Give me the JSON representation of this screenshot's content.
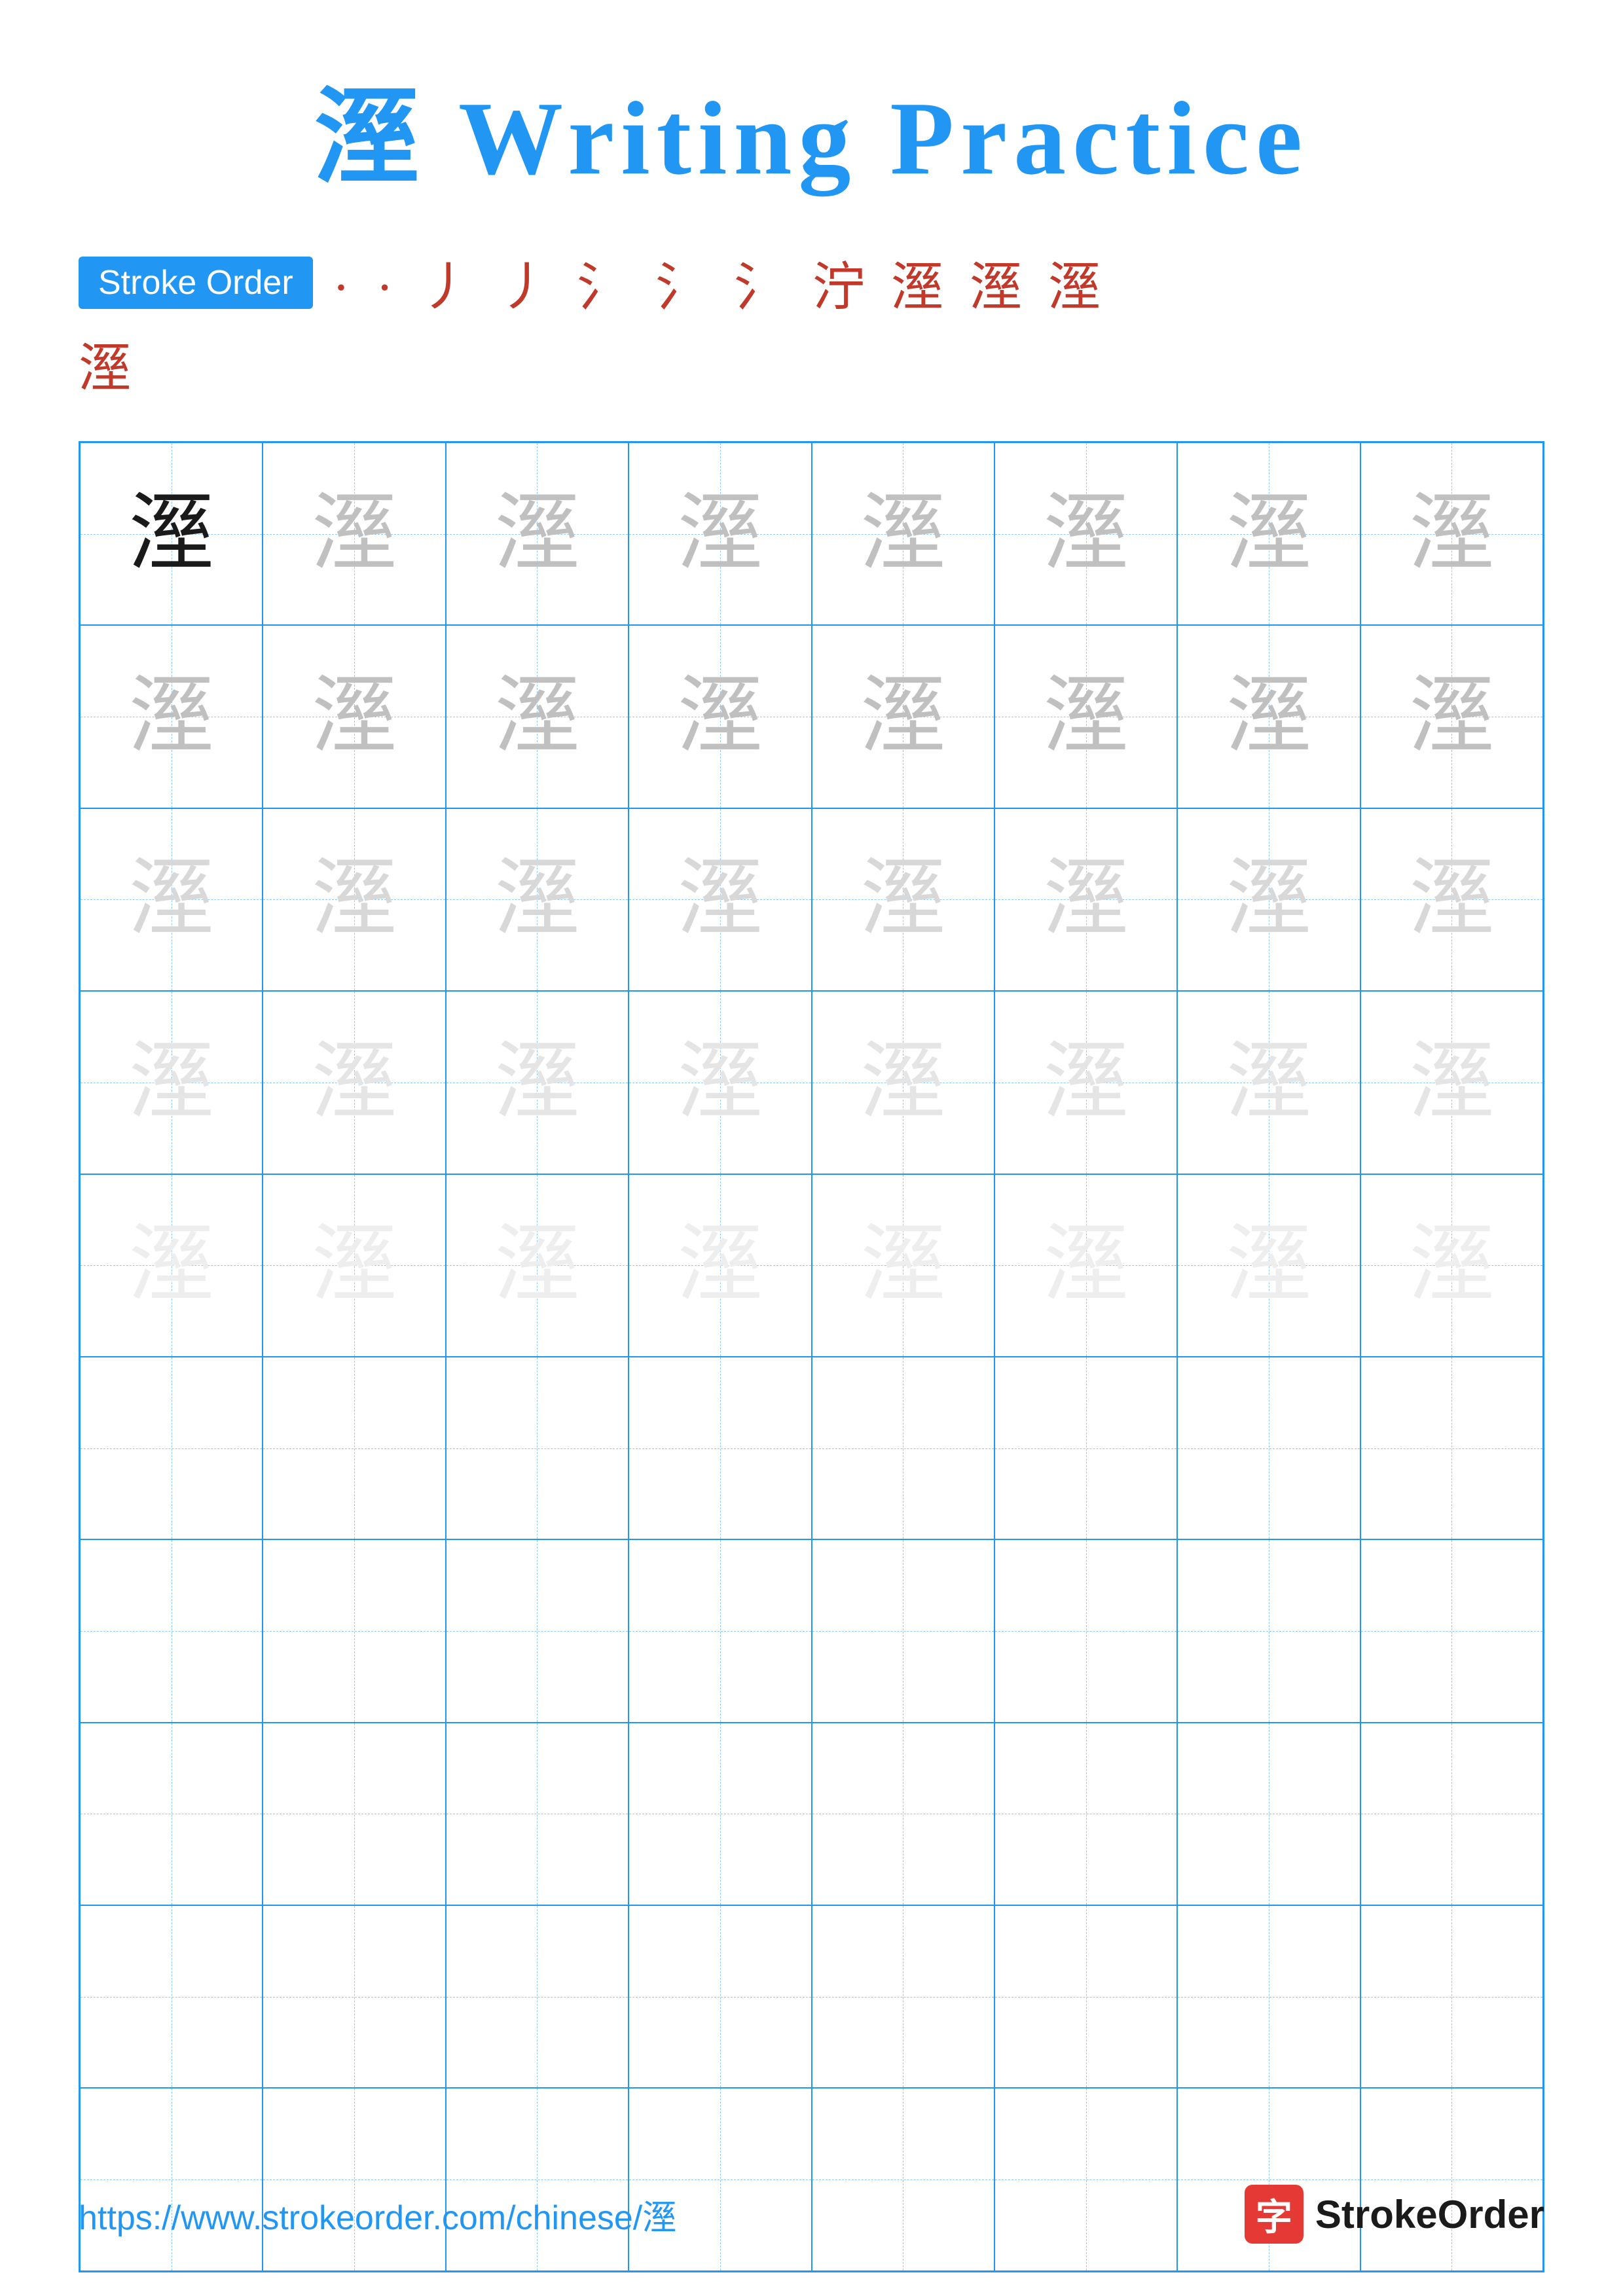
{
  "title": "溼 Writing Practice",
  "title_char": "溼",
  "title_text": "Writing Practice",
  "stroke_order_label": "Stroke Order",
  "stroke_sequence_line1": "` ` ; ; ;` ;` ;彡 ;彡 ;彡 ;彡 ;彡溼 溼",
  "stroke_steps": [
    "·",
    "·",
    "丿",
    "丿",
    "氵",
    "氵",
    "氵",
    "泞",
    "溼",
    "溼",
    "溼"
  ],
  "stroke_display": "` · ; ; ;` ;` ;泞 ;泞 ;泞溼 溼",
  "final_char": "溼",
  "grid": {
    "rows": 10,
    "cols": 8,
    "char": "溼"
  },
  "cell_styles": [
    [
      "dark",
      "medium",
      "medium",
      "medium",
      "medium",
      "medium",
      "medium",
      "medium"
    ],
    [
      "medium",
      "medium",
      "medium",
      "medium",
      "medium",
      "medium",
      "medium",
      "medium"
    ],
    [
      "light",
      "light",
      "light",
      "light",
      "light",
      "light",
      "light",
      "light"
    ],
    [
      "lighter",
      "lighter",
      "lighter",
      "lighter",
      "lighter",
      "lighter",
      "lighter",
      "lighter"
    ],
    [
      "faint",
      "faint",
      "faint",
      "faint",
      "faint",
      "faint",
      "faint",
      "faint"
    ],
    [
      "empty",
      "empty",
      "empty",
      "empty",
      "empty",
      "empty",
      "empty",
      "empty"
    ],
    [
      "empty",
      "empty",
      "empty",
      "empty",
      "empty",
      "empty",
      "empty",
      "empty"
    ],
    [
      "empty",
      "empty",
      "empty",
      "empty",
      "empty",
      "empty",
      "empty",
      "empty"
    ],
    [
      "empty",
      "empty",
      "empty",
      "empty",
      "empty",
      "empty",
      "empty",
      "empty"
    ],
    [
      "empty",
      "empty",
      "empty",
      "empty",
      "empty",
      "empty",
      "empty",
      "empty"
    ]
  ],
  "footer": {
    "url": "https://www.strokeorder.com/chinese/溼",
    "logo_char": "字",
    "logo_text": "StrokeOrder"
  }
}
